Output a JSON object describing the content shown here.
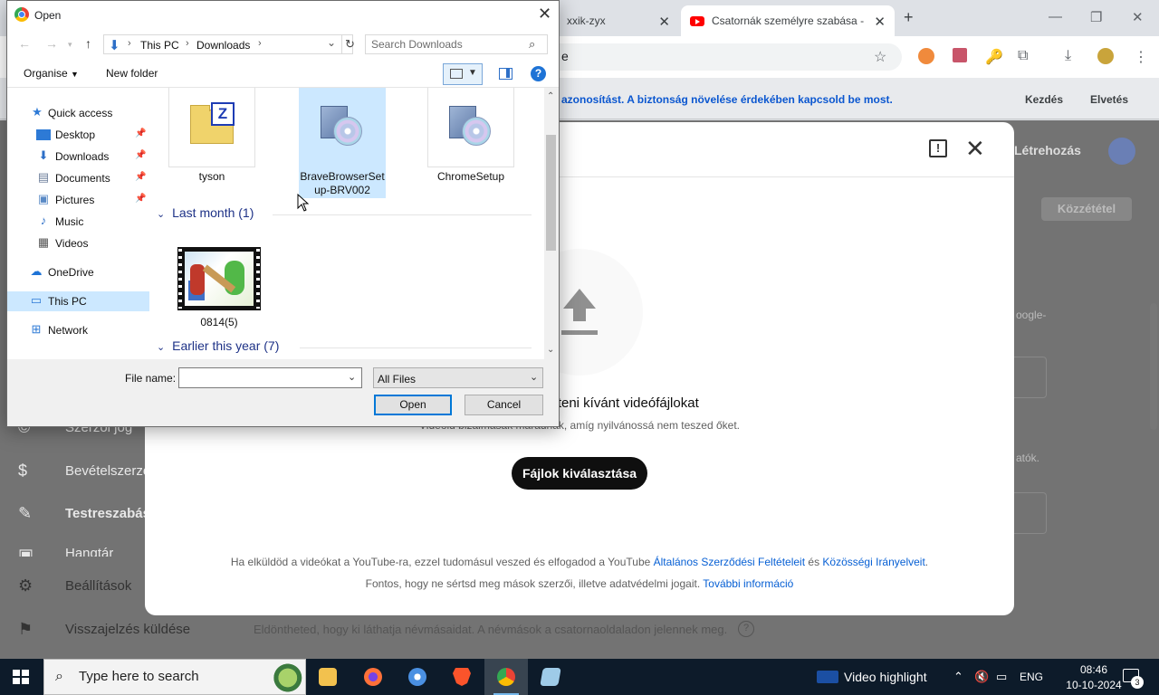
{
  "browser": {
    "tabs": [
      {
        "label": "xxik-zyx"
      },
      {
        "label": "Csatornák személyre szabása -"
      }
    ],
    "url_fragment": "e",
    "infobar": {
      "text": "azonosítást. A biztonság növelése érdekében kapcsold be most.",
      "start_label": "Kezdés",
      "dismiss_label": "Elvetés"
    }
  },
  "studio": {
    "create_label": "Létrehozás",
    "publish_label": "Közzététel",
    "sidebar": [
      {
        "label": "Szerzői jog",
        "icon": "copyright-icon"
      },
      {
        "label": "Bevételszerzés",
        "icon": "dollar-icon"
      },
      {
        "label": "Testreszabás",
        "icon": "magic-wand-icon"
      },
      {
        "label": "Hangtár",
        "icon": "audio-library-icon"
      },
      {
        "label": "Beállítások",
        "icon": "gear-icon"
      },
      {
        "label": "Visszajelzés küldése",
        "icon": "feedback-icon"
      }
    ],
    "right_fragments": {
      "google": "oogle-",
      "tok": "atók."
    },
    "bottom_text": "Eldöntheted, hogy ki láthatja névmásaidat. A névmások a csatornaoldaladon jelennek meg."
  },
  "upload_modal": {
    "heading": "Húzd ide a feltölteni kívánt videófájlokat",
    "subheading": "Videóid bizalmasak maradnak, amíg nyilvánossá nem teszed őket.",
    "select_files_label": "Fájlok kiválasztása",
    "legal_line1_pre": "Ha elküldöd a videókat a YouTube-ra, ezzel tudomásul veszed és elfogadod a YouTube ",
    "legal_terms_link": "Általános Szerződési Feltételeit",
    "legal_and": " és ",
    "legal_guidelines_link": "Közösségi Irányelveit",
    "legal_line1_end": ".",
    "legal_line2_pre": "Fontos, hogy ne sértsd meg mások szerzői, illetve adatvédelmi jogait. ",
    "legal_more_link": "További információ"
  },
  "dialog": {
    "title": "Open",
    "breadcrumb": [
      "This PC",
      "Downloads"
    ],
    "search_placeholder": "Search Downloads",
    "organise_label": "Organise",
    "new_folder_label": "New folder",
    "nav_items": [
      {
        "label": "Quick access",
        "icon": "star-icon",
        "pinned": false
      },
      {
        "label": "Desktop",
        "icon": "desktop-icon",
        "pinned": true
      },
      {
        "label": "Downloads",
        "icon": "download-arrow-icon",
        "pinned": true
      },
      {
        "label": "Documents",
        "icon": "documents-icon",
        "pinned": true
      },
      {
        "label": "Pictures",
        "icon": "pictures-icon",
        "pinned": true
      },
      {
        "label": "Music",
        "icon": "music-icon",
        "pinned": false
      },
      {
        "label": "Videos",
        "icon": "videos-icon",
        "pinned": false
      },
      {
        "label": "OneDrive",
        "icon": "cloud-icon",
        "pinned": false
      },
      {
        "label": "This PC",
        "icon": "computer-icon",
        "pinned": false
      },
      {
        "label": "Network",
        "icon": "network-icon",
        "pinned": false
      }
    ],
    "files_top": [
      {
        "name": "tyson",
        "type": "zip-icon"
      },
      {
        "name": "BraveBrowserSetup-BRV002",
        "name_line1": "BraveBrowserSet",
        "name_line2": "up-BRV002",
        "type": "setup-icon"
      },
      {
        "name": "ChromeSetup",
        "type": "setup-icon"
      }
    ],
    "group_last_month": "Last month (1)",
    "files_last_month": [
      {
        "name": "0814(5)",
        "type": "video-thumbnail"
      }
    ],
    "group_earlier": "Earlier this year (7)",
    "file_name_label": "File name:",
    "file_name_value": "",
    "file_type_value": "All Files",
    "open_label": "Open",
    "cancel_label": "Cancel"
  },
  "taskbar": {
    "search_placeholder": "Type here to search",
    "apps": [
      "file-explorer-icon",
      "firefox-icon",
      "chromium-icon",
      "brave-icon",
      "chrome-icon",
      "notepad-icon"
    ],
    "video_highlight_label": "Video highlight",
    "language": "ENG",
    "time": "08:46",
    "date": "10-10-2024",
    "notification_count": "3"
  }
}
